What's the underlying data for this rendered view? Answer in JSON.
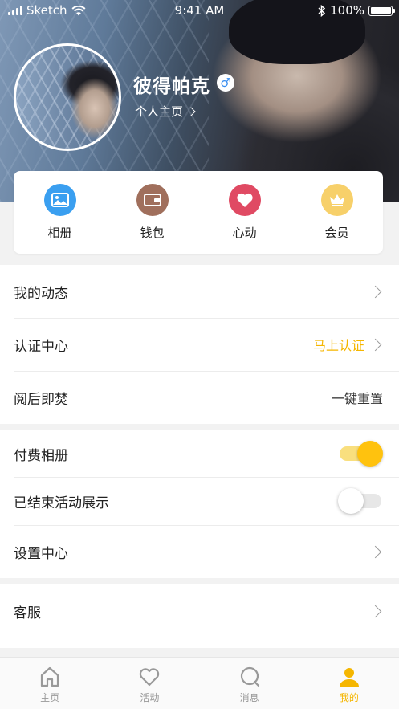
{
  "status_bar": {
    "carrier": "Sketch",
    "time": "9:41 AM",
    "battery": "100%",
    "battery_level": 1.0
  },
  "profile": {
    "name": "彼得帕克",
    "gender_symbol": "♂",
    "homepage_link": "个人主页"
  },
  "quick_actions": [
    {
      "label": "相册",
      "icon": "photo-icon",
      "color": "#3a9ff0"
    },
    {
      "label": "钱包",
      "icon": "wallet-icon",
      "color": "#a06f5c"
    },
    {
      "label": "心动",
      "icon": "heart-icon",
      "color": "#e04a63"
    },
    {
      "label": "会员",
      "icon": "crown-icon",
      "color": "#f7d06a"
    }
  ],
  "settings": {
    "my_posts": {
      "label": "我的动态"
    },
    "verification": {
      "label": "认证中心",
      "action": "马上认证"
    },
    "burn_after_reading": {
      "label": "阅后即焚",
      "action": "一键重置"
    },
    "paid_album": {
      "label": "付费相册",
      "enabled": true
    },
    "show_ended_events": {
      "label": "已结束活动展示",
      "enabled": false
    },
    "settings_center": {
      "label": "设置中心"
    },
    "customer_service": {
      "label": "客服"
    }
  },
  "tab_bar": [
    {
      "label": "主页",
      "icon": "home-icon",
      "active": false
    },
    {
      "label": "活动",
      "icon": "heart-outline-icon",
      "active": false
    },
    {
      "label": "消息",
      "icon": "message-icon",
      "active": false
    },
    {
      "label": "我的",
      "icon": "person-icon",
      "active": true
    }
  ],
  "colors": {
    "accent": "#f5b600",
    "toggle_on_knob": "#ffc20e",
    "toggle_on_track": "#f9df7e",
    "inactive_tab": "#999999"
  }
}
